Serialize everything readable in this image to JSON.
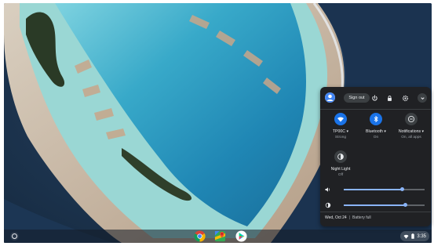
{
  "wallpaper": {
    "icon": "atoll-aerial-image"
  },
  "shelf": {
    "launcher_icon": "launcher-circle-icon",
    "apps": [
      {
        "name": "Chrome",
        "icon": "chrome-icon"
      },
      {
        "name": "Maps",
        "icon": "maps-icon"
      },
      {
        "name": "Play Store",
        "icon": "play-store-icon"
      }
    ],
    "status": {
      "time": "3:35",
      "wifi_icon": "wifi-icon",
      "battery_icon": "battery-icon"
    }
  },
  "tray": {
    "header": {
      "sign_out_label": "Sign out",
      "icons": [
        "power-icon",
        "lock-icon",
        "gear-icon",
        "chevron-down-icon"
      ]
    },
    "tiles": [
      {
        "label": "TP00C ▾",
        "sub": "Strong",
        "icon": "wifi-icon",
        "active": true
      },
      {
        "label": "Bluetooth ▾",
        "sub": "On",
        "icon": "bluetooth-icon",
        "active": true
      },
      {
        "label": "Notifications ▾",
        "sub": "On, all apps",
        "icon": "do-not-disturb-icon",
        "active": false
      },
      {
        "label": "Night Light",
        "sub": "Off",
        "icon": "night-light-icon",
        "active": false
      }
    ],
    "volume": {
      "level": 0.72,
      "icon": "volume-icon"
    },
    "brightness": {
      "level": 0.76,
      "icon": "brightness-icon"
    },
    "footer": {
      "date": "Wed, Oct 24",
      "battery": "Battery full"
    }
  },
  "colors": {
    "accent": "#8ab4f8",
    "tile_active": "#1a73e8",
    "tray_bg": "#202124",
    "tile_inactive": "#3c4043"
  }
}
